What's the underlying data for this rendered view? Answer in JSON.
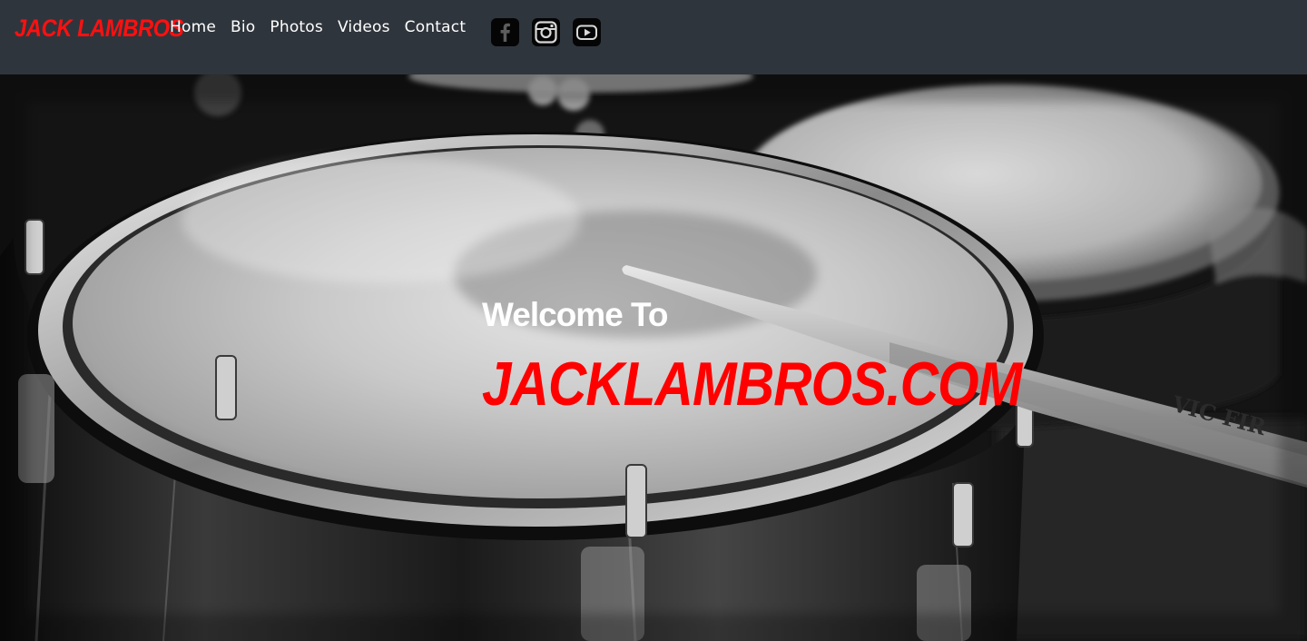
{
  "navbar": {
    "brand": "JACK LAMBROS",
    "links": [
      {
        "label": "Home"
      },
      {
        "label": "Bio"
      },
      {
        "label": "Photos"
      },
      {
        "label": "Videos"
      },
      {
        "label": "Contact"
      }
    ],
    "social": [
      {
        "icon": "facebook-icon"
      },
      {
        "icon": "instagram-icon"
      },
      {
        "icon": "youtube-icon"
      }
    ],
    "background_color": "#2f353c"
  },
  "hero": {
    "welcome": "Welcome To",
    "site_name": "JACKLAMBROS.COM",
    "background_image": "black-and-white photo of a snare drum with a drumstick",
    "accent_color": "#ff0000"
  }
}
